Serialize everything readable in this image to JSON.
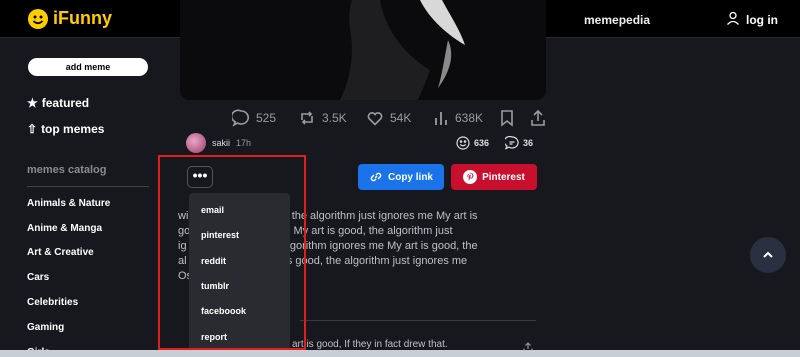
{
  "header": {
    "logo_text": "iFunny",
    "memepedia": "memepedia",
    "login": "log in"
  },
  "sidebar": {
    "add_meme": "add meme",
    "featured": "featured",
    "top_memes": "top memes",
    "catalog_title": "memes catalog",
    "categories": [
      "Animals & Nature",
      "Anime & Manga",
      "Art & Creative",
      "Cars",
      "Celebrities",
      "Gaming",
      "Girls"
    ]
  },
  "post": {
    "stats": {
      "comments": "525",
      "reposts": "3.5K",
      "likes": "54K",
      "views": "638K"
    },
    "author": "sakii",
    "time": "17h",
    "reactions": "636",
    "replies": "36",
    "copy_link": "Copy link",
    "pinterest": "Pinterest",
    "description_lines": [
      "wi               art is good, the algorithm just ignores me My art is",
      "go               ignores me My art is good, the algorithm just",
      "ig               good, the algorithm ignores me My art is good, the",
      "al               me My art is good, the algorithm just ignores me",
      "Os"
    ],
    "comment_text": "art is good, If they in fact drew that."
  },
  "share_menu": {
    "more_label": "•••",
    "items": [
      "email",
      "pinterest",
      "reddit",
      "tumblr",
      "faceboook",
      "report"
    ]
  },
  "colors": {
    "brand": "#ffcc00",
    "copy_link_bg": "#1a73e8",
    "pinterest_bg": "#c8102e",
    "highlight": "#e01e1e"
  }
}
